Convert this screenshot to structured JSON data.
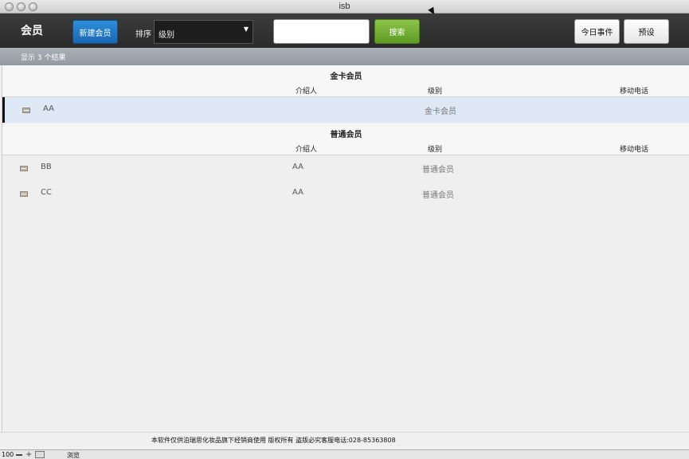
{
  "window": {
    "title": "isb"
  },
  "toolbar": {
    "app_title": "会员",
    "new_member_label": "新建会员",
    "sort_label": "排序",
    "sort_selected": "级别",
    "search_value": "",
    "search_button_label": "搜索",
    "today_events_label": "今日事件",
    "preset_label": "预设"
  },
  "results": {
    "summary": "显示 3 个结果"
  },
  "columns": {
    "referrer": "介绍人",
    "level": "级别",
    "mobile": "移动电话"
  },
  "groups": [
    {
      "title": "金卡会员",
      "rows": [
        {
          "name": "AA",
          "referrer": "",
          "level": "金卡会员",
          "mobile": ""
        }
      ]
    },
    {
      "title": "普通会员",
      "rows": [
        {
          "name": "BB",
          "referrer": "AA",
          "level": "普通会员",
          "mobile": ""
        },
        {
          "name": "CC",
          "referrer": "AA",
          "level": "普通会员",
          "mobile": ""
        }
      ]
    }
  ],
  "footer": {
    "text": "本软件仅供泊瑞思化妆品旗下经销商使用 版权所有 盗版必究客服电话:028-85363808"
  },
  "statusbar": {
    "zoom": "100",
    "mode": "浏览"
  },
  "colors": {
    "toolbar": "#2f2f2f",
    "new_button": "#1d73c4",
    "search_button": "#6fae2f",
    "selected_row": "#dfe8f5"
  }
}
